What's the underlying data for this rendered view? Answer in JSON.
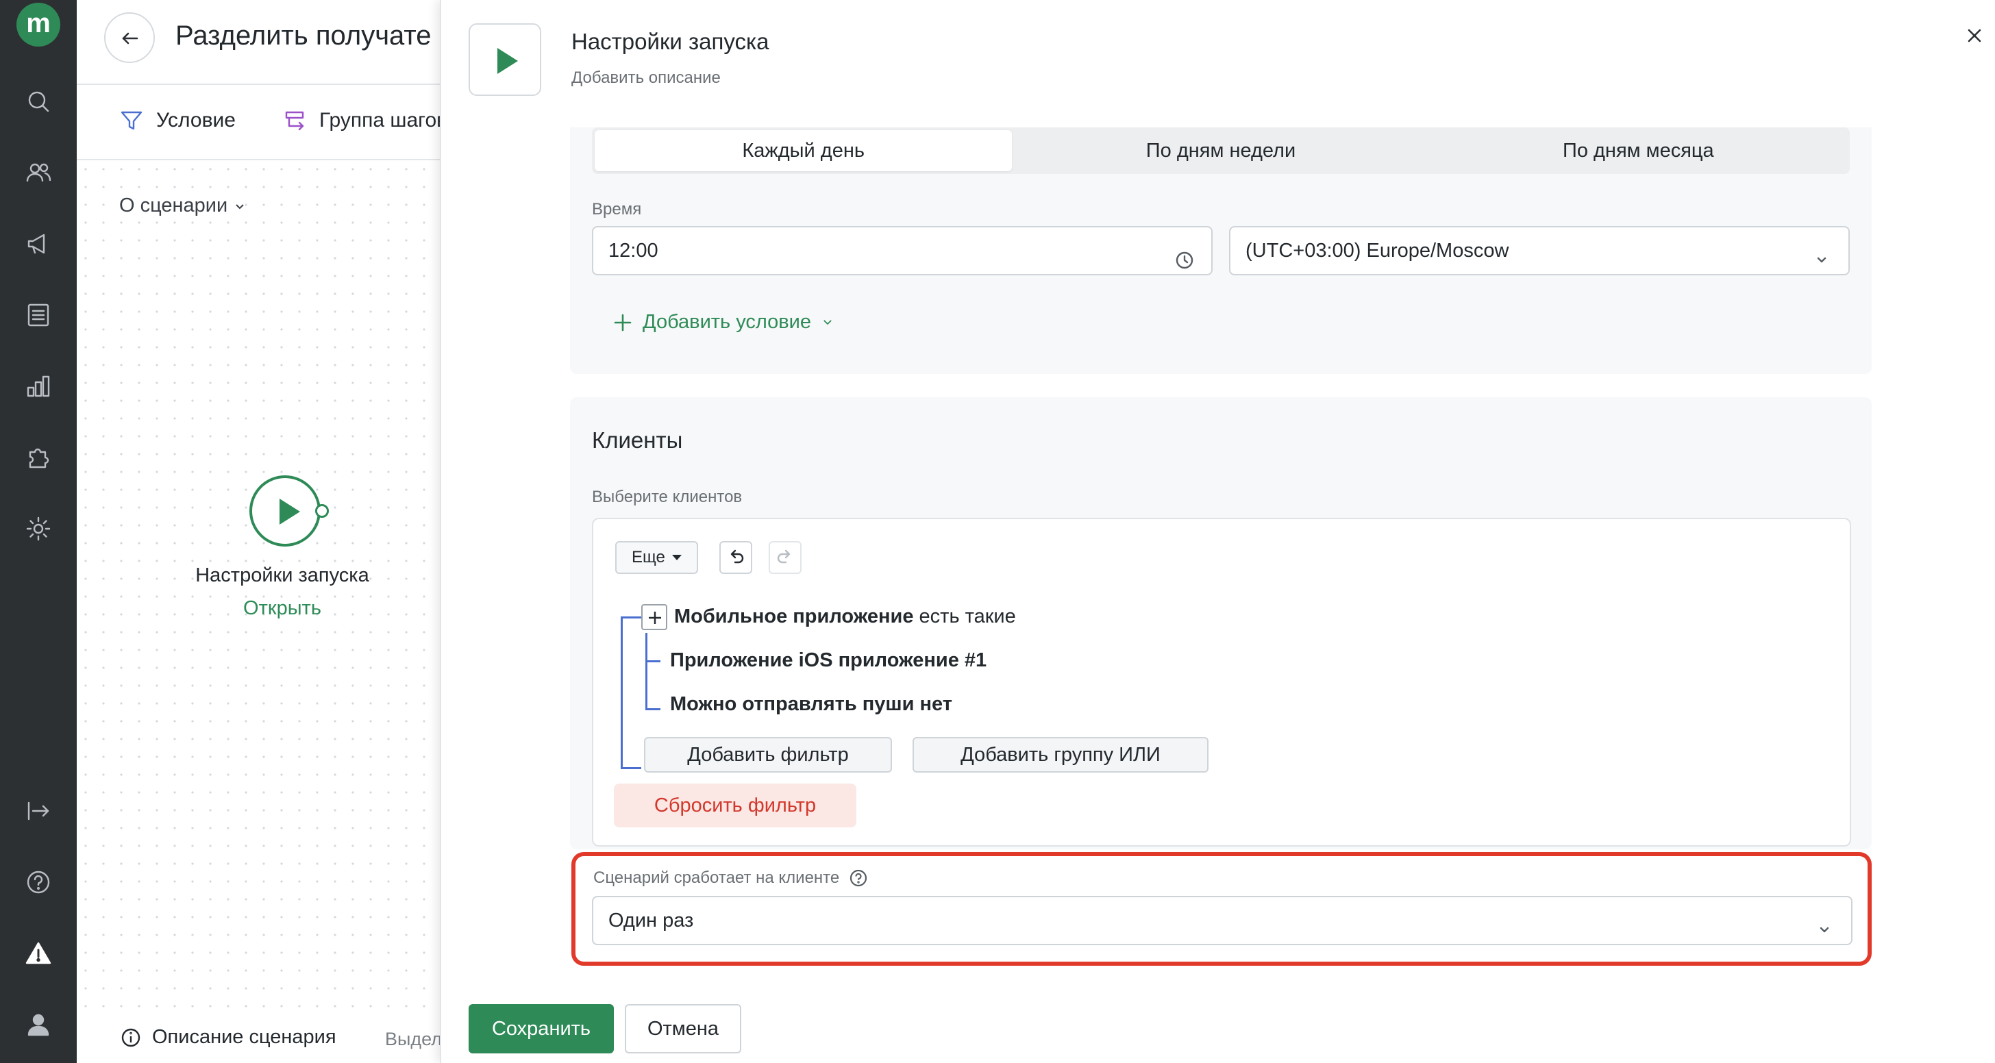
{
  "editor": {
    "title": "Разделить получате",
    "toolbar": {
      "condition": "Условие",
      "step_group": "Группа шагов"
    },
    "about": "О сценарии",
    "node": {
      "title": "Настройки запуска",
      "open": "Открыть"
    },
    "footer": {
      "description": "Описание сценария",
      "highlight": "Выдел"
    }
  },
  "panel": {
    "title": "Настройки запуска",
    "subtitle": "Добавить описание",
    "schedule_tabs": [
      "Каждый день",
      "По дням недели",
      "По дням месяца"
    ],
    "active_tab": "Каждый день",
    "time_label": "Время",
    "time_value": "12:00",
    "timezone": "(UTC+03:00) Europe/Moscow",
    "add_condition": "Добавить условие",
    "clients": {
      "title": "Клиенты",
      "select_label": "Выберите клиентов",
      "more": "Еще",
      "conditions": [
        {
          "bold": "Мобильное приложение",
          "rest": " есть такие"
        },
        {
          "bold": "Приложение iOS приложение #1",
          "rest": ""
        },
        {
          "bold": "Можно отправлять пуши нет",
          "rest": ""
        }
      ],
      "add_filter": "Добавить фильтр",
      "add_or_group": "Добавить группу ИЛИ",
      "reset_filter": "Сбросить фильтр"
    },
    "trigger": {
      "label": "Сценарий сработает на клиенте",
      "value": "Один раз"
    },
    "save": "Сохранить",
    "cancel": "Отмена"
  },
  "colors": {
    "brand": "#2e8b57",
    "rail": "#2d3033",
    "danger": "#e23a2a",
    "tree": "#4a6fd1"
  },
  "icons": [
    "search-icon",
    "users-icon",
    "megaphone-icon",
    "list-icon",
    "chart-icon",
    "puzzle-icon",
    "gear-icon",
    "exit-icon",
    "help-icon",
    "warning-icon",
    "user-icon"
  ]
}
